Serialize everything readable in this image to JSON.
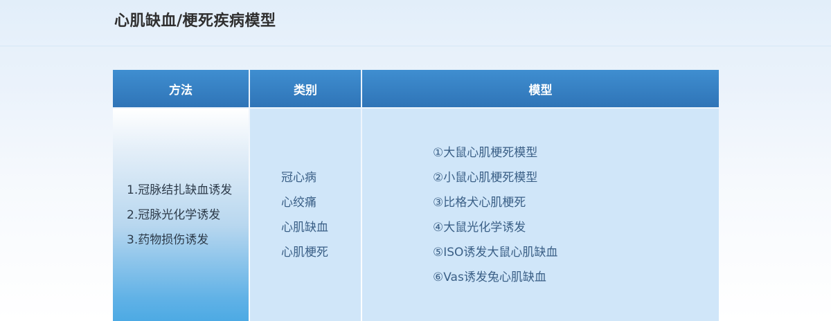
{
  "page": {
    "title": "心肌缺血/梗死疾病模型"
  },
  "table": {
    "headers": [
      "方法",
      "类别",
      "模型"
    ],
    "methods": [
      "1.冠脉结扎缺血诱发",
      "2.冠脉光化学诱发",
      "3.药物损伤诱发"
    ],
    "categories": [
      "冠心病",
      "心绞痛",
      "心肌缺血",
      "心肌梗死"
    ],
    "models": [
      "①大鼠心肌梗死模型",
      "②小鼠心肌梗死模型",
      "③比格犬心肌梗死",
      "④大鼠光化学诱发",
      "⑤ISO诱发大鼠心肌缺血",
      "⑥Vas诱发兔心肌缺血"
    ]
  },
  "colors": {
    "header_blue": "#2f74b7",
    "cell_light_blue": "#d0e6f9",
    "text_blue": "#3a5f86"
  }
}
